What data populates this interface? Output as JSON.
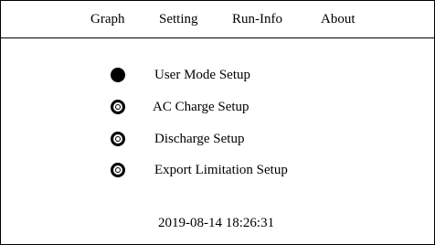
{
  "menu": {
    "items": [
      {
        "label": "Graph"
      },
      {
        "label": "Setting"
      },
      {
        "label": "Run-Info"
      },
      {
        "label": "About"
      }
    ]
  },
  "setup_options": [
    {
      "label": "User Mode Setup",
      "selected": true
    },
    {
      "label": "AC Charge Setup",
      "selected": false
    },
    {
      "label": "Discharge Setup",
      "selected": false
    },
    {
      "label": "Export Limitation Setup",
      "selected": false
    }
  ],
  "status": {
    "datetime": "2019-08-14 18:26:31"
  }
}
